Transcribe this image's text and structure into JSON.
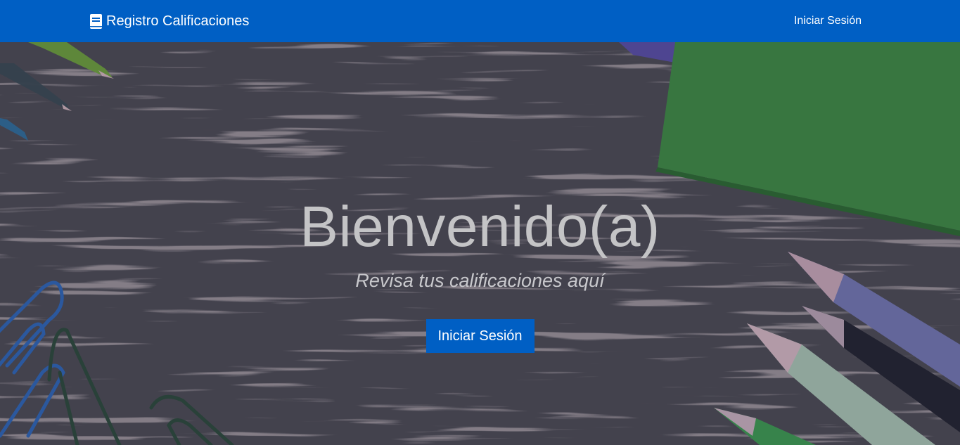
{
  "navbar": {
    "brand_label": "Registro Calificaciones",
    "brand_icon": "book-icon",
    "login_link": "Iniciar Sesión",
    "color": "#005fc4"
  },
  "hero": {
    "title": "Bienvenido(a)",
    "subtitle": "Revisa tus calificaciones aquí",
    "button_label": "Iniciar Sesión",
    "background_image": "wooden desk with colored pencils, pens, paper clips and green notebook"
  }
}
